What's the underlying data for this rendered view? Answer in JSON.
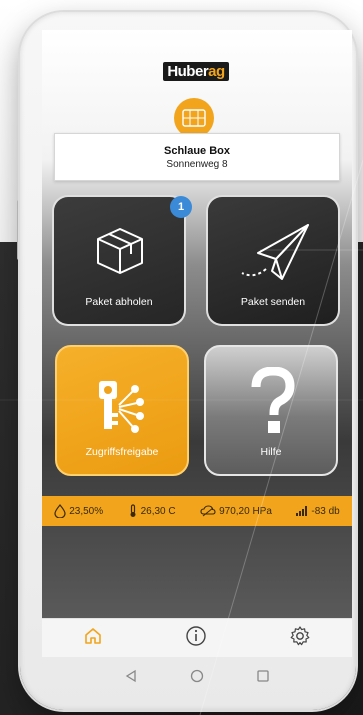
{
  "app": {
    "logo_prefix": "Huber",
    "logo_accent": "ag",
    "brand_color": "#f2a51c"
  },
  "box": {
    "name": "Schlaue Box",
    "address": "Sonnenweg 8"
  },
  "tiles": {
    "pickup_label": "Paket abholen",
    "pickup_badge": "1",
    "send_label": "Paket senden",
    "access_label": "Zugriffsfreigabe",
    "help_label": "Hilfe"
  },
  "status": {
    "humidity": "23,50%",
    "temperature": "26,30 C",
    "pressure": "970,20 HPa",
    "signal": "-83 db"
  },
  "nav": {
    "home_icon": "home-icon",
    "info_icon": "info-icon",
    "settings_icon": "gear-icon"
  },
  "system_nav": {
    "back_icon": "back-triangle-icon",
    "home_icon": "home-circle-icon",
    "recents_icon": "recents-square-icon"
  }
}
